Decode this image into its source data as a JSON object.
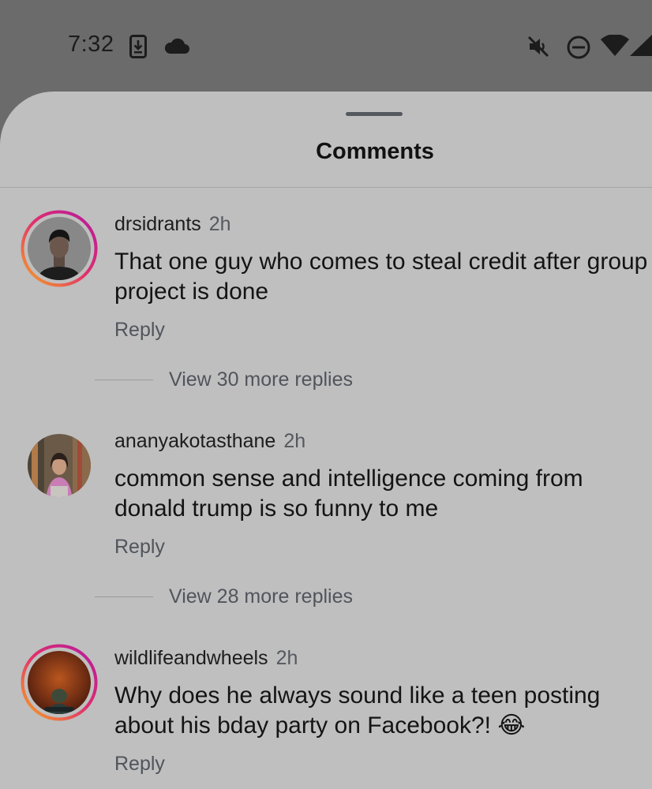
{
  "status_bar": {
    "time": "7:32",
    "icons": [
      "download-icon",
      "cloud-icon",
      "mute-icon",
      "do-not-disturb-icon",
      "wifi-icon",
      "signal-icon"
    ]
  },
  "sheet": {
    "title": "Comments"
  },
  "comments": [
    {
      "username": "drsidrants",
      "time": "2h",
      "text": "That one guy who comes to steal credit after group project is done",
      "reply_label": "Reply",
      "view_replies": "View 30 more replies",
      "has_story_ring": true
    },
    {
      "username": "ananyakotasthane",
      "time": "2h",
      "text": "common sense and intelligence coming from donald trump is so funny to me",
      "reply_label": "Reply",
      "view_replies": "View 28 more replies",
      "has_story_ring": false
    },
    {
      "username": "wildlifeandwheels",
      "time": "2h",
      "text": "Why does he always sound like a teen posting about his bday party on Facebook?! 😂",
      "reply_label": "Reply",
      "has_story_ring": true
    }
  ],
  "colors": {
    "sheet_bg": "#bfbfbf",
    "dim_bg": "#6b6b6b",
    "ring_start": "#f5a623",
    "ring_end": "#c1198a",
    "muted_text": "#50555c"
  }
}
